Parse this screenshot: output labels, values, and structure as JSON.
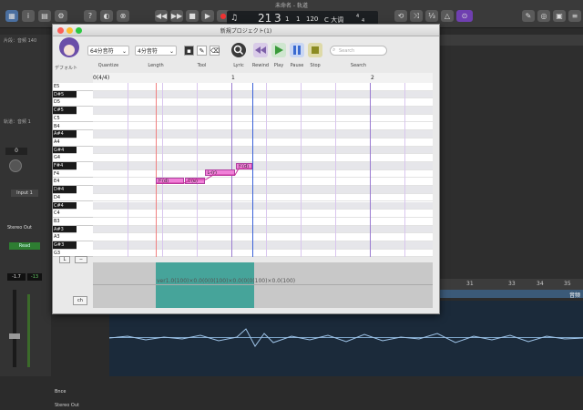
{
  "host": {
    "title": "未命名 - 轨道",
    "lcd": {
      "bar": "21",
      "beat": "3",
      "div": "1",
      "tick": "1",
      "tempo": "120",
      "key": "C 大调",
      "sig_top": "4",
      "sig_bottom": "4"
    },
    "track_header": "片段：音频 140",
    "section_label": "轨道：音频 1",
    "volume": "0",
    "input": "Input 1",
    "output": "Stereo Out",
    "read": "Read",
    "meter_left": "-1.7",
    "meter_right": "-13",
    "bottom_track": "Bnce",
    "bottom_out": "Stereo Out",
    "ruler": {
      "a": "31",
      "b": "33",
      "c": "34",
      "d": "35"
    },
    "right_label": "音频"
  },
  "plugin": {
    "title": "新規プロジェクト(1)",
    "singer_label": "デフォルト",
    "quantize": {
      "value": "64分音符",
      "caption": "Quantize"
    },
    "length": {
      "value": "4分音符",
      "caption": "Length"
    },
    "tool_caption": "Tool",
    "lyric_caption": "Lyric",
    "rewind_caption": "Rewind",
    "play_caption": "Play",
    "pause_caption": "Pause",
    "stop_caption": "Stop",
    "search": {
      "placeholder": "Search",
      "caption": "Search"
    },
    "timeline": {
      "sig": "0(4/4)",
      "m1": "1",
      "m2": "2"
    },
    "keys": [
      "E5",
      "D#5",
      "D5",
      "C#5",
      "C5",
      "B4",
      "A#4",
      "A4",
      "G#4",
      "G4",
      "F#4",
      "F4",
      "E4",
      "D#4",
      "D4",
      "C#4",
      "C4",
      "B3",
      "A#3",
      "A3",
      "G#3",
      "G3"
    ],
    "notes": [
      "ド(d)",
      "ミ(e)",
      "レ(r)",
      "ド(d)"
    ],
    "param_text": "ver1.0(100)×0.0(0(0(100)×0.0(0(0(100)×0.0(100)",
    "btn_l": "L",
    "btn_dash": "−",
    "btn_ch": "ch"
  },
  "colors": {
    "note": "#f080d8",
    "param": "#2f9d92",
    "play": "#3a9a3a",
    "pause": "#3a6ad0",
    "stop": "#8b8b22"
  }
}
